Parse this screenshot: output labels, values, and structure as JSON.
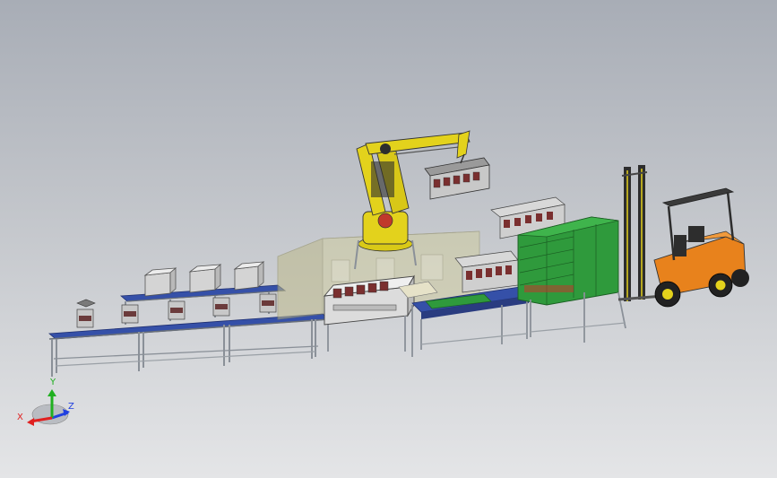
{
  "view": {
    "background_top": "#a8adb6",
    "background_bottom": "#e4e5e7"
  },
  "scene": {
    "items": [
      "conveyor-line",
      "carton-boxes",
      "wrapping-station",
      "robot-cell-enclosure",
      "palletizing-robot-arm",
      "robot-gripper",
      "product-cases",
      "pallet-rack",
      "forklift"
    ],
    "colors": {
      "robot": "#e3d21c",
      "conveyor_belt": "#3550a8",
      "frame": "#9aa0a6",
      "pallet": "#2f9a3c",
      "forklift_body": "#e8821c",
      "enclosure": "#c9c79a"
    }
  },
  "triad": {
    "x_label": "X",
    "y_label": "Y",
    "z_label": "Z",
    "x_color": "#e02020",
    "y_color": "#20b020",
    "z_color": "#2040e0"
  }
}
